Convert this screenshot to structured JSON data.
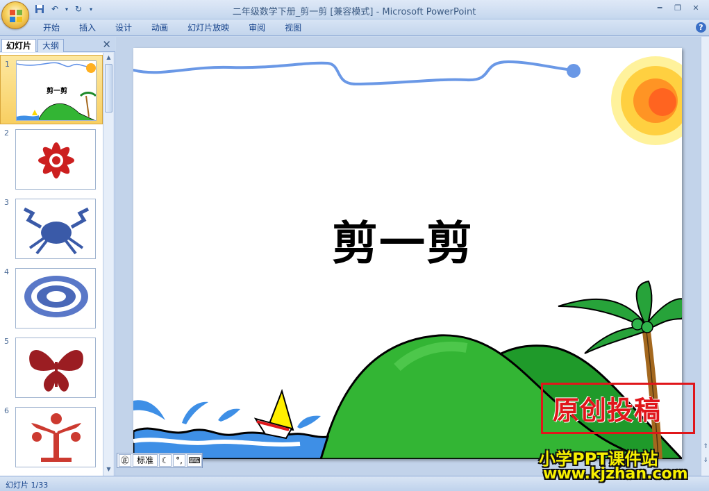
{
  "window": {
    "title": "二年级数学下册_剪一剪 [兼容模式] - Microsoft PowerPoint"
  },
  "ribbon": {
    "tabs": [
      "开始",
      "插入",
      "设计",
      "动画",
      "幻灯片放映",
      "审阅",
      "视图"
    ],
    "help": "?"
  },
  "left_pane": {
    "tabs": [
      "幻灯片",
      "大纲"
    ],
    "close": "✕",
    "thumbnails": [
      {
        "number": "1",
        "title": "剪一剪",
        "selected": true
      },
      {
        "number": "2",
        "title": "",
        "selected": false
      },
      {
        "number": "3",
        "title": "",
        "selected": false
      },
      {
        "number": "4",
        "title": "",
        "selected": false
      },
      {
        "number": "5",
        "title": "",
        "selected": false
      },
      {
        "number": "6",
        "title": "",
        "selected": false
      }
    ]
  },
  "slide": {
    "title": "剪一剪"
  },
  "ime": {
    "mode": "标准"
  },
  "status_bar": {
    "slide_info": "幻灯片 1/33"
  },
  "watermark": {
    "stamp": "原创投稿",
    "line1": "小学PPT课件站",
    "line2": "www.kjzhan.com"
  },
  "colors": {
    "hill_green": "#33b534",
    "sea_blue": "#3e8fe6",
    "sun_orange": "#ff7a1a",
    "stamp_red": "#e0161b",
    "cutout_red": "#cc1f1f",
    "cutout_blue": "#3a5aa8"
  }
}
